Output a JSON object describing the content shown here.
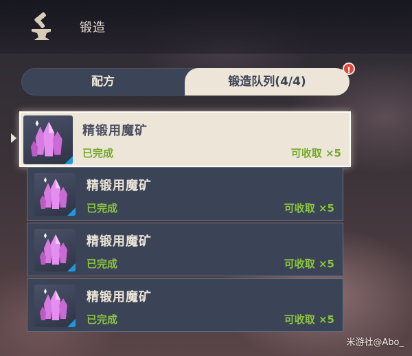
{
  "header": {
    "title": "锻造",
    "icon": "anvil-hammer-icon"
  },
  "tabs": [
    {
      "label": "配方",
      "active": false
    },
    {
      "label": "锻造队列(4/4)",
      "active": true
    }
  ],
  "alert_badge": "!",
  "queue": [
    {
      "name": "精锻用魔矿",
      "status": "已完成",
      "collect": "可收取 ×5",
      "icon": "crystal-ore-icon",
      "selected": true
    },
    {
      "name": "精锻用魔矿",
      "status": "已完成",
      "collect": "可收取 ×5",
      "icon": "crystal-ore-icon",
      "selected": false
    },
    {
      "name": "精锻用魔矿",
      "status": "已完成",
      "collect": "可收取 ×5",
      "icon": "crystal-ore-icon",
      "selected": false
    },
    {
      "name": "精锻用魔矿",
      "status": "已完成",
      "collect": "可收取 ×5",
      "icon": "crystal-ore-icon",
      "selected": false
    }
  ],
  "watermark": "米游社@Abo_",
  "colors": {
    "accent_green": "#8cc53e",
    "selected_bg": "#ece5d8",
    "row_bg": "#3b4356",
    "rarity_blue": "#1e98e0",
    "alert_red": "#e0443a"
  }
}
